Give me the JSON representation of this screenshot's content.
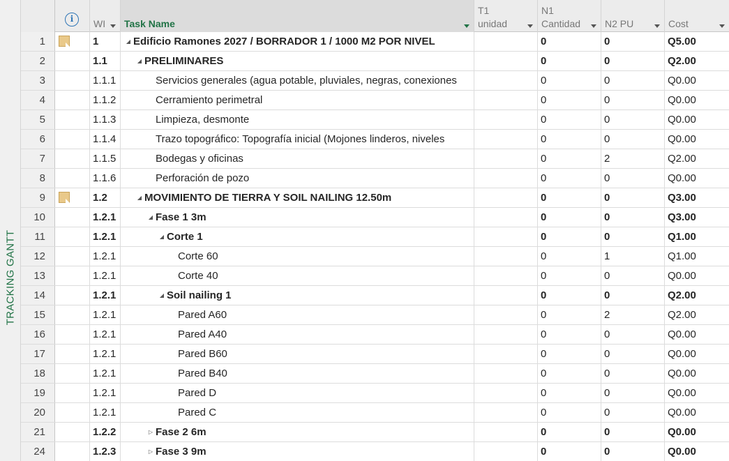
{
  "sidebar": {
    "view_label": "TRACKING GANTT"
  },
  "columns": {
    "info_icon": "info-icon",
    "wbs": "WI",
    "task_name": "Task Name",
    "t1_top": "T1",
    "t1_bottom": "unidad",
    "n1_top": "N1",
    "n1_bottom": "Cantidad",
    "n2": "N2 PU",
    "cost": "Cost"
  },
  "colors": {
    "accent": "#217346",
    "info": "#2e75b6",
    "note": "#e9c98a"
  },
  "rows": [
    {
      "id": "1",
      "wbs": "1",
      "name": "Edificio Ramones 2027 / BORRADOR 1 / 1000 M2 POR NIVEL",
      "t1": "",
      "n1": "0",
      "n2": "0",
      "cost": "Q5.00",
      "level": 0,
      "summary": true,
      "toggle": "expanded",
      "note": true
    },
    {
      "id": "2",
      "wbs": "1.1",
      "name": "PRELIMINARES",
      "t1": "",
      "n1": "0",
      "n2": "0",
      "cost": "Q2.00",
      "level": 1,
      "summary": true,
      "toggle": "expanded",
      "note": false
    },
    {
      "id": "3",
      "wbs": "1.1.1",
      "name": "Servicios generales (agua potable, pluviales, negras, conexiones",
      "t1": "",
      "n1": "0",
      "n2": "0",
      "cost": "Q0.00",
      "level": 2,
      "summary": false,
      "toggle": "",
      "note": false
    },
    {
      "id": "4",
      "wbs": "1.1.2",
      "name": "Cerramiento perimetral",
      "t1": "",
      "n1": "0",
      "n2": "0",
      "cost": "Q0.00",
      "level": 2,
      "summary": false,
      "toggle": "",
      "note": false
    },
    {
      "id": "5",
      "wbs": "1.1.3",
      "name": "Limpieza, desmonte",
      "t1": "",
      "n1": "0",
      "n2": "0",
      "cost": "Q0.00",
      "level": 2,
      "summary": false,
      "toggle": "",
      "note": false
    },
    {
      "id": "6",
      "wbs": "1.1.4",
      "name": "Trazo topográfico: Topografía inicial (Mojones linderos, niveles",
      "t1": "",
      "n1": "0",
      "n2": "0",
      "cost": "Q0.00",
      "level": 2,
      "summary": false,
      "toggle": "",
      "note": false
    },
    {
      "id": "7",
      "wbs": "1.1.5",
      "name": "Bodegas y oficinas",
      "t1": "",
      "n1": "0",
      "n2": "2",
      "cost": "Q2.00",
      "level": 2,
      "summary": false,
      "toggle": "",
      "note": false
    },
    {
      "id": "8",
      "wbs": "1.1.6",
      "name": "Perforación de pozo",
      "t1": "",
      "n1": "0",
      "n2": "0",
      "cost": "Q0.00",
      "level": 2,
      "summary": false,
      "toggle": "",
      "note": false
    },
    {
      "id": "9",
      "wbs": "1.2",
      "name": "MOVIMIENTO DE TIERRA Y SOIL NAILING 12.50m",
      "t1": "",
      "n1": "0",
      "n2": "0",
      "cost": "Q3.00",
      "level": 1,
      "summary": true,
      "toggle": "expanded",
      "note": true
    },
    {
      "id": "10",
      "wbs": "1.2.1",
      "name": "Fase 1 3m",
      "t1": "",
      "n1": "0",
      "n2": "0",
      "cost": "Q3.00",
      "level": 2,
      "summary": true,
      "toggle": "expanded",
      "note": false
    },
    {
      "id": "11",
      "wbs": "1.2.1",
      "name": "Corte 1",
      "t1": "",
      "n1": "0",
      "n2": "0",
      "cost": "Q1.00",
      "level": 3,
      "summary": true,
      "toggle": "expanded",
      "note": false
    },
    {
      "id": "12",
      "wbs": "1.2.1",
      "name": "Corte 60",
      "t1": "",
      "n1": "0",
      "n2": "1",
      "cost": "Q1.00",
      "level": 4,
      "summary": false,
      "toggle": "",
      "note": false
    },
    {
      "id": "13",
      "wbs": "1.2.1",
      "name": "Corte 40",
      "t1": "",
      "n1": "0",
      "n2": "0",
      "cost": "Q0.00",
      "level": 4,
      "summary": false,
      "toggle": "",
      "note": false
    },
    {
      "id": "14",
      "wbs": "1.2.1",
      "name": "Soil nailing 1",
      "t1": "",
      "n1": "0",
      "n2": "0",
      "cost": "Q2.00",
      "level": 3,
      "summary": true,
      "toggle": "expanded",
      "note": false
    },
    {
      "id": "15",
      "wbs": "1.2.1",
      "name": "Pared A60",
      "t1": "",
      "n1": "0",
      "n2": "2",
      "cost": "Q2.00",
      "level": 4,
      "summary": false,
      "toggle": "",
      "note": false
    },
    {
      "id": "16",
      "wbs": "1.2.1",
      "name": "Pared A40",
      "t1": "",
      "n1": "0",
      "n2": "0",
      "cost": "Q0.00",
      "level": 4,
      "summary": false,
      "toggle": "",
      "note": false
    },
    {
      "id": "17",
      "wbs": "1.2.1",
      "name": "Pared B60",
      "t1": "",
      "n1": "0",
      "n2": "0",
      "cost": "Q0.00",
      "level": 4,
      "summary": false,
      "toggle": "",
      "note": false
    },
    {
      "id": "18",
      "wbs": "1.2.1",
      "name": "Pared B40",
      "t1": "",
      "n1": "0",
      "n2": "0",
      "cost": "Q0.00",
      "level": 4,
      "summary": false,
      "toggle": "",
      "note": false
    },
    {
      "id": "19",
      "wbs": "1.2.1",
      "name": "Pared D",
      "t1": "",
      "n1": "0",
      "n2": "0",
      "cost": "Q0.00",
      "level": 4,
      "summary": false,
      "toggle": "",
      "note": false
    },
    {
      "id": "20",
      "wbs": "1.2.1",
      "name": "Pared C",
      "t1": "",
      "n1": "0",
      "n2": "0",
      "cost": "Q0.00",
      "level": 4,
      "summary": false,
      "toggle": "",
      "note": false
    },
    {
      "id": "21",
      "wbs": "1.2.2",
      "name": "Fase 2 6m",
      "t1": "",
      "n1": "0",
      "n2": "0",
      "cost": "Q0.00",
      "level": 2,
      "summary": true,
      "toggle": "collapsed",
      "note": false
    },
    {
      "id": "24",
      "wbs": "1.2.3",
      "name": "Fase 3 9m",
      "t1": "",
      "n1": "0",
      "n2": "0",
      "cost": "Q0.00",
      "level": 2,
      "summary": true,
      "toggle": "collapsed",
      "note": false
    }
  ]
}
